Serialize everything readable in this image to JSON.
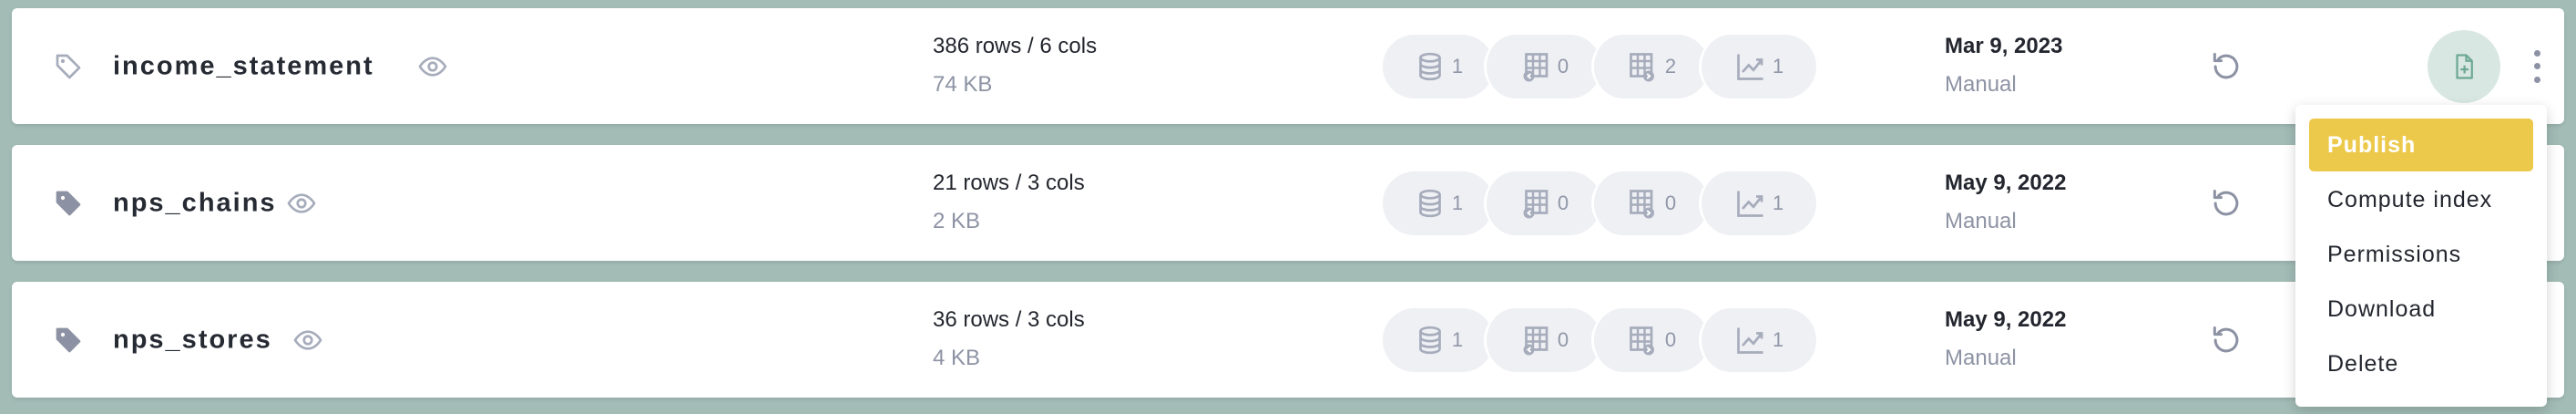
{
  "datasets": [
    {
      "name": "income_statement",
      "tag_filled": false,
      "size_main": "386 rows / 6 cols",
      "size_sub": "74 KB",
      "stats": [
        "1",
        "0",
        "2",
        "1"
      ],
      "date": "Mar 9, 2023",
      "mode": "Manual"
    },
    {
      "name": "nps_chains",
      "tag_filled": true,
      "size_main": "21 rows / 3 cols",
      "size_sub": "2 KB",
      "stats": [
        "1",
        "0",
        "0",
        "1"
      ],
      "date": "May 9, 2022",
      "mode": "Manual"
    },
    {
      "name": "nps_stores",
      "tag_filled": true,
      "size_main": "36 rows / 3 cols",
      "size_sub": "4 KB",
      "stats": [
        "1",
        "0",
        "0",
        "1"
      ],
      "date": "May 9, 2022",
      "mode": "Manual"
    }
  ],
  "stat_icons": [
    "database-icon",
    "table-in-icon",
    "table-out-icon",
    "chart-icon"
  ],
  "menu": {
    "items": [
      "Publish",
      "Compute index",
      "Permissions",
      "Download",
      "Delete"
    ],
    "active_index": 0
  },
  "colors": {
    "background": "#a3bcb6",
    "menu_active": "#ecc94b",
    "publish_button_bg": "#d8e7e2",
    "icon_muted": "#8c92a3"
  }
}
